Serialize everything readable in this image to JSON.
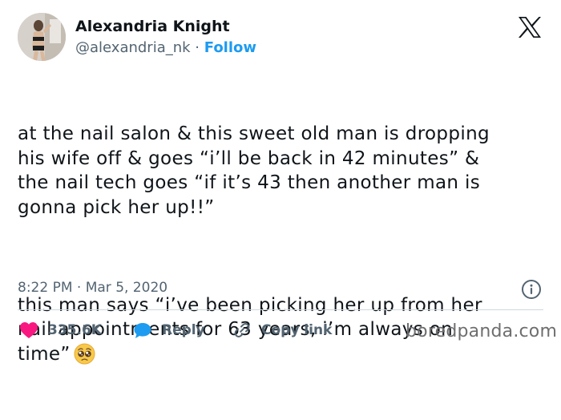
{
  "author": {
    "name": "Alexandria Knight",
    "handle": "@alexandria_nk",
    "separator": " · ",
    "follow_label": "Follow"
  },
  "brand_icon": "x-logo-icon",
  "tweet": {
    "paragraph1": "at the nail salon & this sweet old man is dropping\nhis wife off & goes “i’ll be back in 42 minutes” &\nthe nail tech goes “if it’s 43 then another man is\ngonna pick her up!!”",
    "paragraph2": "this man says “i’ve been picking her up from her\nnail appointments for 63 years, i’m always on\ntime”",
    "emoji": "pleading-face-emoji"
  },
  "timestamp": "8:22 PM · Mar 5, 2020",
  "actions": {
    "likes_count": "335.6K",
    "reply_label": "Reply",
    "copy_label": "Copy link"
  },
  "watermark": "boredpanda.com",
  "colors": {
    "accent": "#1d9bf0",
    "like": "#f91880",
    "text": "#0f1419",
    "muted": "#536471",
    "divider": "#cfd9de"
  }
}
